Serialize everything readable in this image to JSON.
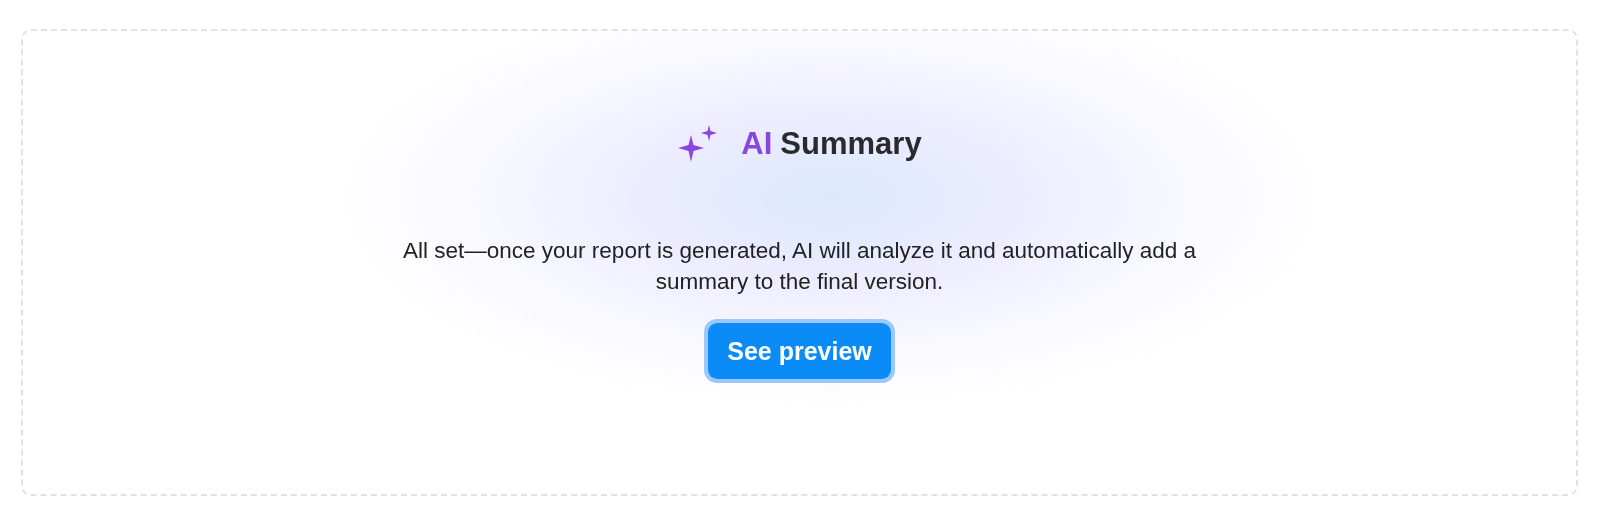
{
  "card": {
    "title": {
      "accent": "AI",
      "text": "Summary"
    },
    "message": "All set—once your report is generated, AI will analyze it and automatically add a summary to the final version.",
    "button": {
      "label": "See preview"
    }
  }
}
